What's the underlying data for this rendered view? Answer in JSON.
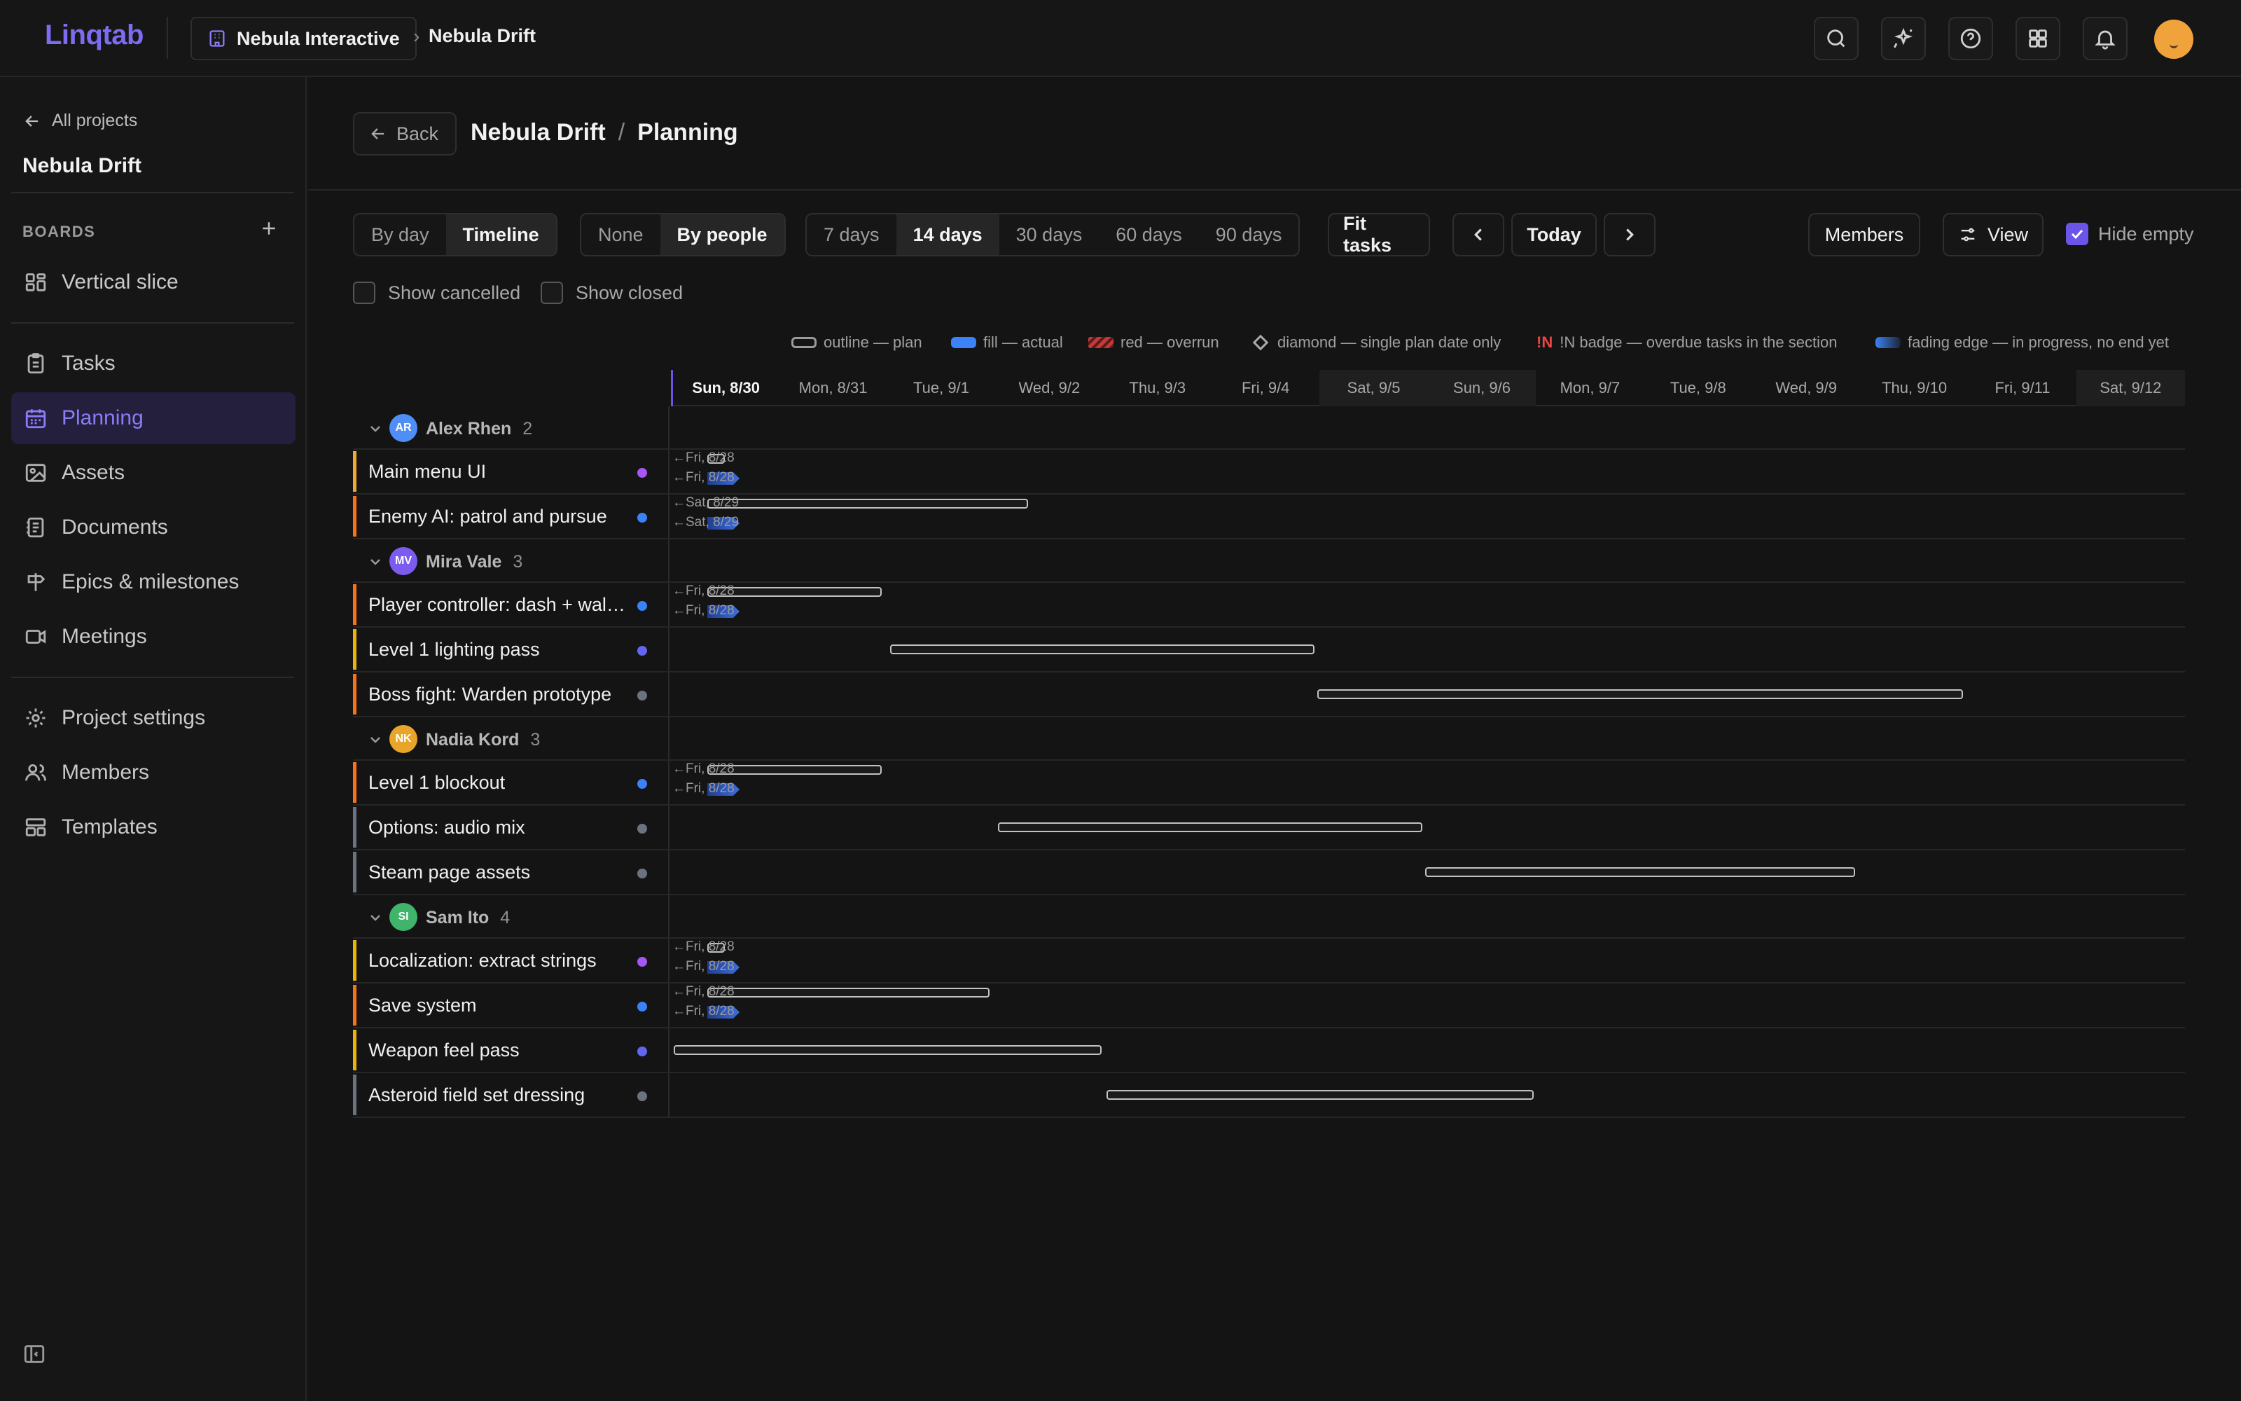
{
  "app": {
    "logo": "Linqtab",
    "org": "Nebula Interactive",
    "crumb_sep": "›",
    "project": "Nebula Drift"
  },
  "sidebar": {
    "all_projects": "All projects",
    "project": "Nebula Drift",
    "boards_label": "BOARDS",
    "boards": [
      {
        "label": "Vertical slice",
        "icon": "board-icon"
      }
    ],
    "nav": [
      {
        "label": "Tasks",
        "icon": "clipboard-icon"
      },
      {
        "label": "Planning",
        "icon": "calendar-icon",
        "active": true
      },
      {
        "label": "Assets",
        "icon": "image-icon"
      },
      {
        "label": "Documents",
        "icon": "document-icon"
      },
      {
        "label": "Epics & milestones",
        "icon": "signpost-icon"
      },
      {
        "label": "Meetings",
        "icon": "video-icon"
      }
    ],
    "settings_nav": [
      {
        "label": "Project settings",
        "icon": "gear-icon"
      },
      {
        "label": "Members",
        "icon": "users-icon"
      },
      {
        "label": "Templates",
        "icon": "template-icon"
      }
    ]
  },
  "header": {
    "back": "Back",
    "project": "Nebula Drift",
    "sep": "/",
    "page": "Planning"
  },
  "toolbar": {
    "mode": [
      "By day",
      "Timeline"
    ],
    "group": [
      "None",
      "By people"
    ],
    "ranges": [
      "7 days",
      "14 days",
      "30 days",
      "60 days",
      "90 days"
    ],
    "fit": "Fit tasks",
    "today": "Today",
    "members": "Members",
    "view": "View",
    "hide_empty": "Hide empty",
    "show_cancelled": "Show cancelled",
    "show_closed": "Show closed"
  },
  "legend": {
    "outline": "outline — plan",
    "fill": "fill — actual",
    "red": "red — overrun",
    "diamond": "diamond — single plan date only",
    "badge_sym": "!N",
    "badge": "!N badge — overdue tasks in the section",
    "fade": "fading edge — in progress, no end yet"
  },
  "dates": [
    "Sun, 8/30",
    "Mon, 8/31",
    "Tue, 9/1",
    "Wed, 9/2",
    "Thu, 9/3",
    "Fri, 9/4",
    "Sat, 9/5",
    "Sun, 9/6",
    "Mon, 9/7",
    "Tue, 9/8",
    "Wed, 9/9",
    "Thu, 9/10",
    "Fri, 9/11",
    "Sat, 9/12"
  ],
  "colors": {
    "accent": "#6a55e8",
    "orange": "#f97316",
    "yellow": "#eab308",
    "gray": "#6b7280",
    "dot_purple": "#a855f7",
    "dot_blue": "#3b82f6",
    "dot_indigo": "#6366f1",
    "dot_gray": "#6b7280"
  },
  "groups": [
    {
      "initials": "AR",
      "name": "Alex Rhen",
      "count": "2",
      "color": "#4f8ef7",
      "tasks": [
        {
          "name": "Main menu UI",
          "plan_label": "←Fri, 8/28",
          "actual_label": "←Fri, 8/28"
        },
        {
          "name": "Enemy AI: patrol and pursue",
          "plan_label": "←Sat, 8/29",
          "actual_label": "←Sat, 8/29"
        }
      ]
    },
    {
      "initials": "MV",
      "name": "Mira Vale",
      "count": "3",
      "color": "#7c5cf0",
      "tasks": [
        {
          "name": "Player controller: dash + wall jump",
          "plan_label": "←Fri, 8/28",
          "actual_label": "←Fri, 8/28"
        },
        {
          "name": "Level 1 lighting pass"
        },
        {
          "name": "Boss fight: Warden prototype"
        }
      ]
    },
    {
      "initials": "NK",
      "name": "Nadia Kord",
      "count": "3",
      "color": "#e8a52a",
      "tasks": [
        {
          "name": "Level 1 blockout",
          "plan_label": "←Fri, 8/28",
          "actual_label": "←Fri, 8/28"
        },
        {
          "name": "Options: audio mix"
        },
        {
          "name": "Steam page assets"
        }
      ]
    },
    {
      "initials": "SI",
      "name": "Sam Ito",
      "count": "4",
      "color": "#3fb46a",
      "tasks": [
        {
          "name": "Localization: extract strings",
          "plan_label": "←Fri, 8/28",
          "actual_label": "←Fri, 8/28"
        },
        {
          "name": "Save system",
          "plan_label": "←Fri, 8/28",
          "actual_label": "←Fri, 8/28"
        },
        {
          "name": "Weapon feel pass"
        },
        {
          "name": "Asteroid field set dressing"
        }
      ]
    }
  ]
}
